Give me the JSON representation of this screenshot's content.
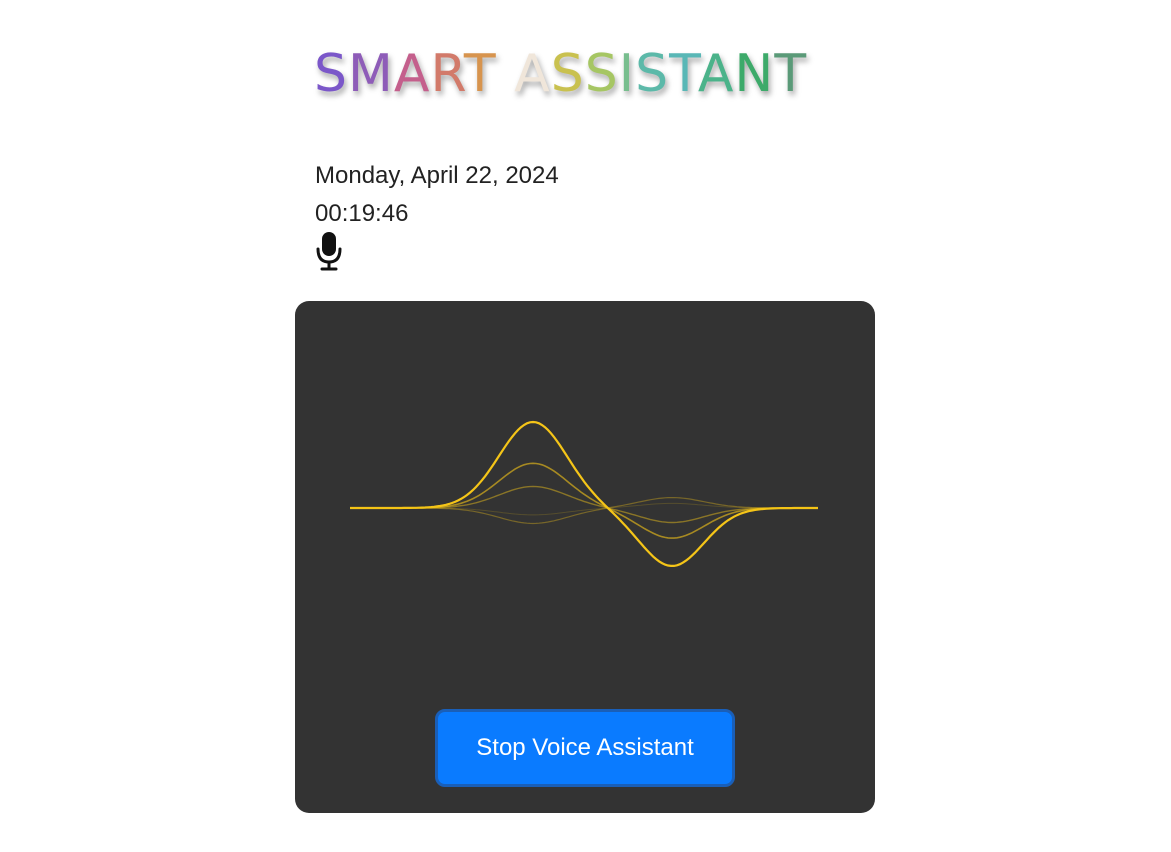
{
  "app": {
    "title": "SMART ASSISTANT",
    "title_colors": [
      "#7b57c9",
      "#8e5cb8",
      "#c45f8c",
      "#d27a6a",
      "#d7944e",
      "#f0e6da",
      "#c9c14f",
      "#a6c663",
      "#78be8e",
      "#5cb9a9",
      "#59b7b6",
      "#4bb38a",
      "#3daa6a",
      "#5a9a78",
      "#7a8f97"
    ]
  },
  "clock": {
    "date": "Monday, April 22, 2024",
    "time": "00:19:46"
  },
  "icons": {
    "microphone": "microphone-icon"
  },
  "panel": {
    "background": "#333333",
    "wave_color": "#f5c518"
  },
  "controls": {
    "stop_label": "Stop Voice Assistant"
  }
}
